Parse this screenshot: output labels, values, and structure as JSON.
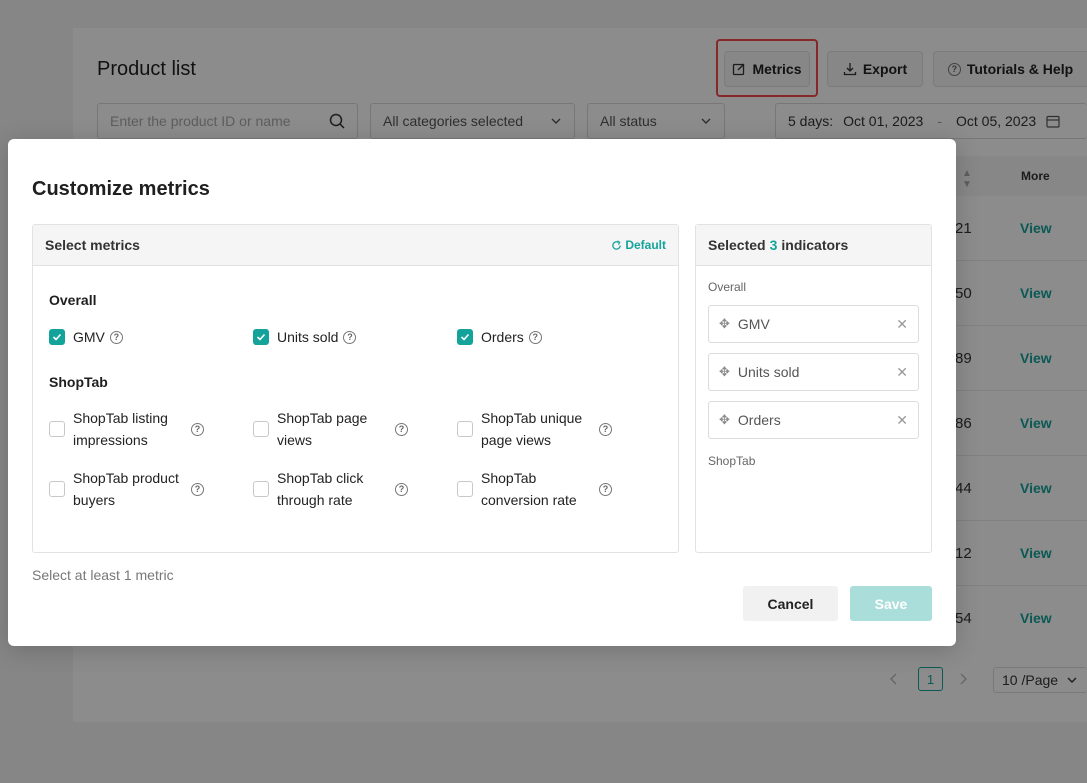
{
  "background": {
    "title": "Product list",
    "buttons": {
      "metrics": "Metrics",
      "export": "Export",
      "help": "Tutorials & Help"
    },
    "filters": {
      "search_placeholder": "Enter the product ID or name",
      "category": "All categories selected",
      "status": "All status",
      "date_label": "5 days:",
      "date_from": "Oct 01, 2023",
      "date_sep": "-",
      "date_to": "Oct 05, 2023"
    },
    "table": {
      "more_header": "More",
      "rows": [
        {
          "value": "21",
          "action": "View"
        },
        {
          "value": "50",
          "action": "View"
        },
        {
          "value": "89",
          "action": "View"
        },
        {
          "value": "86",
          "action": "View"
        },
        {
          "value": "44",
          "action": "View"
        },
        {
          "value": "12",
          "action": "View"
        },
        {
          "value": "54",
          "action": "View"
        }
      ]
    },
    "pagination": {
      "current": "1",
      "page_size": "10 /Page"
    }
  },
  "modal": {
    "title": "Customize metrics",
    "select_panel": {
      "heading": "Select metrics",
      "default_label": "Default",
      "groups": [
        {
          "name": "Overall",
          "items": [
            {
              "label": "GMV",
              "checked": true
            },
            {
              "label": "Units sold",
              "checked": true
            },
            {
              "label": "Orders",
              "checked": true
            }
          ]
        },
        {
          "name": "ShopTab",
          "items": [
            {
              "label_line1": "ShopTab listing",
              "label_line2": "impressions",
              "checked": false
            },
            {
              "label_line1": "ShopTab page",
              "label_line2": "views",
              "checked": false
            },
            {
              "label_line1": "ShopTab unique",
              "label_line2": "page views",
              "checked": false
            },
            {
              "label_line1": "ShopTab product",
              "label_line2": "buyers",
              "checked": false
            },
            {
              "label_line1": "ShopTab click",
              "label_line2": "through rate",
              "checked": false
            },
            {
              "label_line1": "ShopTab",
              "label_line2": "conversion rate",
              "checked": false
            }
          ]
        }
      ]
    },
    "selected_panel": {
      "heading_prefix": "Selected",
      "count": "3",
      "heading_suffix": "indicators",
      "overall_label": "Overall",
      "shoptab_label": "ShopTab",
      "items": [
        "GMV",
        "Units sold",
        "Orders"
      ]
    },
    "hint": "Select at least 1 metric",
    "cancel_label": "Cancel",
    "save_label": "Save"
  },
  "colors": {
    "accent": "#14a39a",
    "accent_disabled": "#a9dedb",
    "highlight": "#f04a4a"
  }
}
